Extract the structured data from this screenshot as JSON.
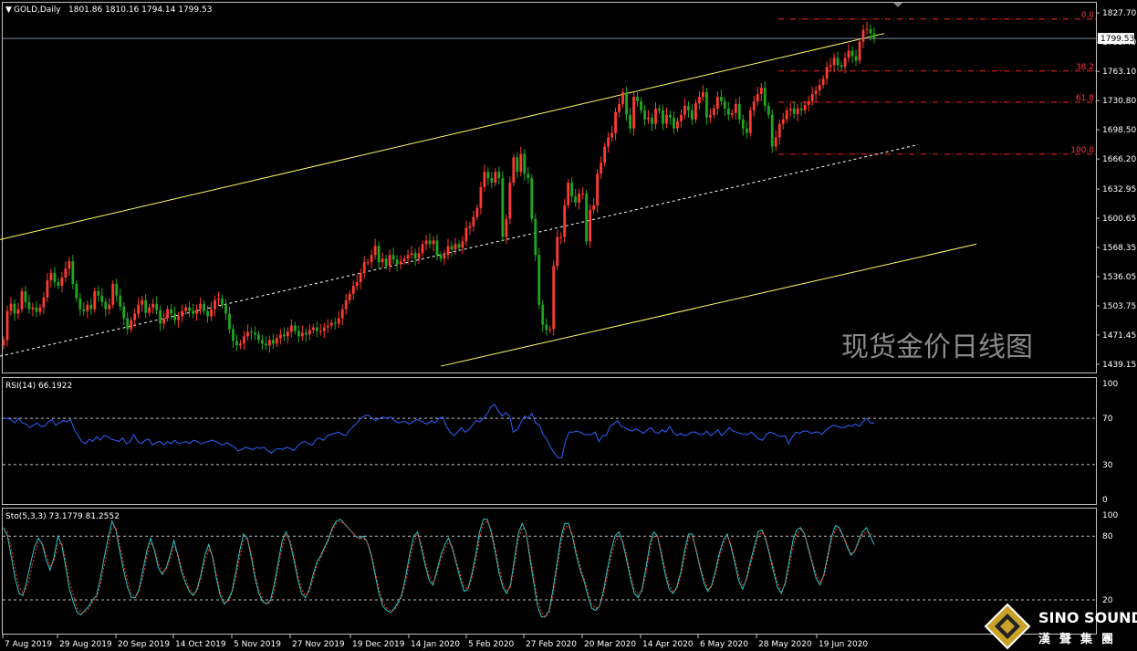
{
  "chart_data": [
    {
      "type": "candlestick",
      "title": "GOLD,Daily",
      "ohlc_readout": "1801.86 1810.16 1794.14 1799.53",
      "last_price": "1799.53",
      "last_price_value": 1799.53,
      "ylim": [
        1430,
        1838
      ],
      "y_ticks": [
        "1827.70",
        "1795.40",
        "1763.10",
        "1730.80",
        "1698.50",
        "1666.20",
        "1632.95",
        "1600.65",
        "1568.35",
        "1536.05",
        "1503.75",
        "1471.45",
        "1439.15"
      ],
      "y_tick_values": [
        1827.7,
        1795.4,
        1763.1,
        1730.8,
        1698.5,
        1666.2,
        1632.95,
        1600.65,
        1568.35,
        1536.05,
        1503.75,
        1471.45,
        1439.15
      ],
      "x_ticks": [
        "7 Aug 2019",
        "29 Aug 2019",
        "20 Sep 2019",
        "14 Oct 2019",
        "5 Nov 2019",
        "27 Nov 2019",
        "19 Dec 2019",
        "14 Jan 2020",
        "5 Feb 2020",
        "27 Feb 2020",
        "20 Mar 2020",
        "14 Apr 2020",
        "6 May 2020",
        "28 May 2020",
        "19 Jun 2020"
      ],
      "fibonacci": [
        {
          "label": "0.0",
          "value": 1821.0
        },
        {
          "label": "38.2",
          "value": 1763.5
        },
        {
          "label": "61.8",
          "value": 1729.0
        },
        {
          "label": "100.0",
          "value": 1671.5
        }
      ],
      "bull_color": "#ff3b30",
      "bear_color": "#1fa81f",
      "trend_color": "#ffff66",
      "watermark": "现货金价日线图",
      "closes": [
        1466,
        1498,
        1506,
        1495,
        1500,
        1520,
        1508,
        1500,
        1502,
        1497,
        1502,
        1513,
        1532,
        1540,
        1530,
        1526,
        1535,
        1545,
        1553,
        1528,
        1512,
        1500,
        1498,
        1505,
        1500,
        1520,
        1515,
        1508,
        1500,
        1505,
        1528,
        1515,
        1503,
        1490,
        1478,
        1488,
        1495,
        1505,
        1510,
        1496,
        1502,
        1506,
        1499,
        1484,
        1490,
        1500,
        1495,
        1488,
        1492,
        1498,
        1502,
        1498,
        1495,
        1500,
        1506,
        1498,
        1492,
        1500,
        1510,
        1512,
        1505,
        1495,
        1478,
        1465,
        1460,
        1462,
        1470,
        1475,
        1474,
        1472,
        1466,
        1462,
        1460,
        1466,
        1462,
        1468,
        1472,
        1470,
        1475,
        1482,
        1476,
        1470,
        1474,
        1472,
        1477,
        1480,
        1476,
        1476,
        1480,
        1482,
        1485,
        1484,
        1490,
        1500,
        1510,
        1517,
        1526,
        1530,
        1540,
        1552,
        1552,
        1560,
        1570,
        1552,
        1556,
        1548,
        1560,
        1555,
        1550,
        1553,
        1556,
        1560,
        1562,
        1556,
        1562,
        1572,
        1576,
        1572,
        1576,
        1560,
        1556,
        1560,
        1570,
        1566,
        1572,
        1568,
        1575,
        1590,
        1592,
        1602,
        1612,
        1635,
        1652,
        1645,
        1640,
        1652,
        1645,
        1580,
        1600,
        1640,
        1668,
        1652,
        1672,
        1650,
        1645,
        1600,
        1560,
        1505,
        1483,
        1477,
        1478,
        1548,
        1580,
        1580,
        1615,
        1640,
        1625,
        1618,
        1628,
        1628,
        1575,
        1610,
        1615,
        1650,
        1662,
        1680,
        1690,
        1695,
        1718,
        1727,
        1740,
        1715,
        1700,
        1735,
        1730,
        1720,
        1710,
        1712,
        1705,
        1722,
        1720,
        1705,
        1715,
        1712,
        1700,
        1708,
        1715,
        1725,
        1720,
        1710,
        1728,
        1735,
        1740,
        1712,
        1715,
        1722,
        1735,
        1730,
        1722,
        1715,
        1717,
        1727,
        1710,
        1700,
        1695,
        1720,
        1730,
        1738,
        1745,
        1725,
        1715,
        1680,
        1690,
        1705,
        1710,
        1720,
        1722,
        1716,
        1722,
        1720,
        1726,
        1730,
        1738,
        1742,
        1748,
        1755,
        1768,
        1770,
        1778,
        1770,
        1768,
        1778,
        1786,
        1780,
        1775,
        1796,
        1809,
        1810,
        1805,
        1800
      ],
      "upper_trend": {
        "x": [
          0,
          969
        ],
        "y": [
          1577,
          1805
        ]
      },
      "mid_trend": {
        "x": [
          0,
          1006
        ],
        "y": [
          1448,
          1682
        ]
      },
      "lower_trend": {
        "x": [
          483,
          1070
        ],
        "y": [
          1437,
          1572
        ]
      }
    },
    {
      "type": "line",
      "title": "RSI(14) 66.1922",
      "ylim": [
        0,
        100
      ],
      "y_ticks": [
        "100",
        "70",
        "30",
        "0"
      ],
      "y_tick_values": [
        100,
        70,
        30,
        0
      ],
      "levels": [
        70,
        30
      ],
      "series": [
        {
          "color": "#2f62ff",
          "values": [
            70,
            70,
            69,
            66,
            70,
            66,
            65,
            62,
            64,
            66,
            63,
            63,
            67,
            69,
            64,
            66,
            68,
            67,
            69,
            60,
            55,
            50,
            48,
            52,
            50,
            54,
            51,
            55,
            54,
            52,
            51,
            50,
            53,
            48,
            50,
            56,
            50,
            48,
            51,
            52,
            47,
            49,
            50,
            47,
            50,
            48,
            51,
            48,
            49,
            50,
            48,
            51,
            50,
            48,
            49,
            50,
            51,
            50,
            48,
            47,
            49,
            47,
            45,
            42,
            43,
            45,
            44,
            43,
            45,
            44,
            45,
            42,
            40,
            43,
            44,
            43,
            45,
            44,
            42,
            46,
            49,
            50,
            48,
            47,
            52,
            53,
            51,
            55,
            56,
            57,
            58,
            56,
            55,
            60,
            63,
            66,
            70,
            72,
            73,
            70,
            68,
            70,
            71,
            70,
            71,
            68,
            66,
            67,
            67,
            65,
            67,
            69,
            68,
            66,
            65,
            68,
            66,
            70,
            71,
            63,
            58,
            55,
            58,
            62,
            58,
            60,
            64,
            68,
            67,
            70,
            74,
            80,
            82,
            76,
            72,
            75,
            72,
            58,
            60,
            66,
            72,
            70,
            74,
            66,
            64,
            56,
            52,
            45,
            40,
            36,
            36,
            50,
            58,
            58,
            59,
            58,
            56,
            56,
            56,
            58,
            50,
            55,
            55,
            63,
            65,
            68,
            63,
            62,
            60,
            59,
            61,
            59,
            57,
            60,
            62,
            58,
            57,
            60,
            58,
            63,
            58,
            55,
            57,
            55,
            56,
            58,
            58,
            56,
            56,
            59,
            55,
            57,
            60,
            55,
            58,
            62,
            59,
            58,
            57,
            56,
            56,
            58,
            55,
            52,
            51,
            56,
            58,
            57,
            55,
            54,
            55,
            48,
            54,
            58,
            57,
            59,
            59,
            57,
            58,
            58,
            56,
            60,
            62,
            64,
            63,
            62,
            62,
            64,
            63,
            65,
            63,
            67,
            70,
            66,
            66
          ]
        }
      ]
    },
    {
      "type": "line",
      "title": "Sto(5,3,3) 73.1779 81.2552",
      "ylim": [
        -11,
        106
      ],
      "y_ticks": [
        "100",
        "80",
        "20"
      ],
      "y_tick_values": [
        100,
        80,
        20
      ],
      "levels": [
        80,
        20
      ],
      "series": [
        {
          "color": "#2ec6c6",
          "values": [
            88,
            80,
            60,
            40,
            26,
            24,
            38,
            55,
            70,
            78,
            72,
            58,
            48,
            60,
            80,
            72,
            52,
            30,
            18,
            8,
            6,
            10,
            14,
            20,
            24,
            40,
            60,
            78,
            94,
            86,
            66,
            48,
            32,
            22,
            22,
            30,
            48,
            66,
            78,
            66,
            50,
            44,
            50,
            62,
            76,
            62,
            46,
            36,
            28,
            24,
            30,
            44,
            62,
            72,
            60,
            40,
            24,
            16,
            20,
            28,
            46,
            66,
            82,
            78,
            60,
            40,
            26,
            18,
            16,
            20,
            36,
            56,
            76,
            84,
            74,
            58,
            40,
            26,
            22,
            30,
            44,
            56,
            62,
            70,
            78,
            88,
            94,
            96,
            92,
            88,
            84,
            80,
            78,
            80,
            74,
            62,
            44,
            26,
            14,
            10,
            8,
            12,
            18,
            26,
            44,
            64,
            80,
            84,
            68,
            52,
            38,
            34,
            48,
            62,
            72,
            78,
            68,
            54,
            40,
            28,
            30,
            44,
            62,
            84,
            96,
            96,
            84,
            66,
            46,
            32,
            26,
            34,
            58,
            82,
            92,
            84,
            60,
            36,
            14,
            4,
            4,
            10,
            30,
            54,
            78,
            92,
            92,
            80,
            62,
            48,
            38,
            24,
            12,
            10,
            14,
            28,
            48,
            66,
            80,
            84,
            74,
            58,
            40,
            26,
            22,
            30,
            50,
            72,
            84,
            80,
            62,
            44,
            30,
            26,
            32,
            46,
            66,
            82,
            82,
            66,
            50,
            36,
            28,
            34,
            48,
            64,
            76,
            82,
            70,
            54,
            38,
            30,
            40,
            56,
            70,
            84,
            86,
            76,
            62,
            46,
            32,
            26,
            36,
            56,
            76,
            86,
            88,
            82,
            68,
            54,
            40,
            34,
            44,
            62,
            80,
            90,
            88,
            80,
            70,
            62,
            66,
            76,
            84,
            88,
            80,
            72
          ]
        },
        {
          "color": "#ff3b30",
          "values": [
            86,
            84,
            68,
            48,
            32,
            26,
            32,
            46,
            62,
            74,
            74,
            62,
            52,
            56,
            72,
            74,
            58,
            38,
            24,
            12,
            8,
            8,
            12,
            18,
            22,
            34,
            52,
            70,
            88,
            88,
            72,
            54,
            38,
            26,
            22,
            28,
            42,
            60,
            74,
            68,
            54,
            46,
            48,
            58,
            70,
            64,
            50,
            40,
            30,
            26,
            28,
            40,
            56,
            68,
            62,
            44,
            28,
            18,
            18,
            26,
            40,
            60,
            76,
            78,
            64,
            44,
            30,
            20,
            16,
            18,
            30,
            50,
            70,
            82,
            76,
            62,
            44,
            30,
            24,
            28,
            40,
            52,
            60,
            68,
            76,
            86,
            92,
            94,
            92,
            88,
            84,
            80,
            78,
            78,
            74,
            64,
            48,
            30,
            18,
            12,
            10,
            10,
            16,
            24,
            38,
            58,
            74,
            82,
            72,
            56,
            42,
            36,
            44,
            58,
            68,
            74,
            70,
            56,
            44,
            32,
            30,
            40,
            56,
            78,
            92,
            94,
            86,
            70,
            52,
            36,
            28,
            32,
            52,
            76,
            88,
            84,
            64,
            42,
            20,
            8,
            4,
            8,
            24,
            48,
            72,
            88,
            90,
            82,
            66,
            52,
            40,
            28,
            16,
            12,
            14,
            24,
            42,
            60,
            74,
            80,
            76,
            62,
            44,
            30,
            24,
            28,
            44,
            66,
            80,
            80,
            66,
            48,
            34,
            28,
            30,
            42,
            60,
            78,
            80,
            68,
            52,
            40,
            30,
            32,
            44,
            60,
            72,
            80,
            72,
            58,
            42,
            34,
            38,
            52,
            66,
            80,
            84,
            78,
            64,
            50,
            36,
            28,
            34,
            50,
            70,
            82,
            86,
            82,
            70,
            56,
            44,
            36,
            42,
            58,
            76,
            86,
            86,
            80,
            72,
            64,
            66,
            74,
            82,
            84,
            82,
            81
          ]
        }
      ]
    }
  ],
  "logo": {
    "name": "SINO SOUND",
    "sub": "漢聲集團"
  }
}
